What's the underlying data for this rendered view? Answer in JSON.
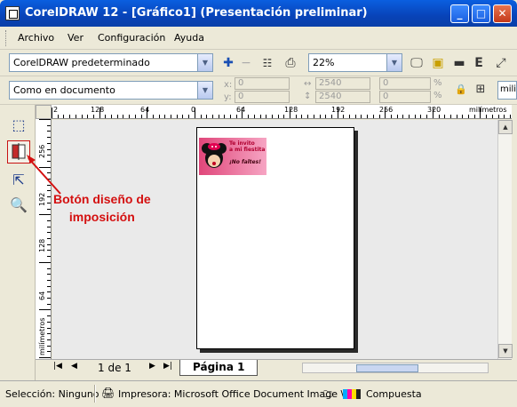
{
  "window": {
    "title": "CorelDRAW 12 - [Gráfico1] (Presentación preliminar)",
    "minimize": "_",
    "maximize": "□",
    "close": "✕"
  },
  "menu": [
    "Archivo",
    "Ver",
    "Configuración",
    "Ayuda"
  ],
  "toolbar1": {
    "preset_value": "CorelDRAW predeterminado",
    "zoom_value": "22%",
    "icons": [
      "plus-icon",
      "minus-icon",
      "options-icon",
      "print-icon",
      "monitor-icon",
      "color-separation-icon",
      "film-icon",
      "letter-e-icon",
      "expand-icon"
    ],
    "letter_e": "E"
  },
  "toolbar2": {
    "position_value": "Como en documento",
    "x_label": "x:",
    "x_value": "0",
    "y_label": "y:",
    "y_value": "0",
    "width_value": "2540",
    "height_value": "2540",
    "scale_x": "0",
    "scale_y": "0",
    "pct": "%",
    "units_value": "mili"
  },
  "ruler": {
    "unit": "milímetros",
    "h_labels": [
      "2",
      "128",
      "64",
      "0",
      "64",
      "128",
      "192",
      "256",
      "320"
    ],
    "v_labels": [
      "256",
      "192",
      "128",
      "64",
      "0"
    ]
  },
  "page": {
    "invite_line1": "Te invito",
    "invite_line2": "a mi fiestita",
    "invite_line3": "¡No faltes!"
  },
  "navigation": {
    "page_count": "1 de 1",
    "page_tab": "Página 1"
  },
  "status": {
    "selection": "Selección: Ninguno",
    "printer": "Impresora: Microsoft Office Document Image \\",
    "mode": "Compuesta"
  },
  "annotation": {
    "line1": "Botón diseño de",
    "line2": "imposición",
    "color": "#d41010"
  }
}
